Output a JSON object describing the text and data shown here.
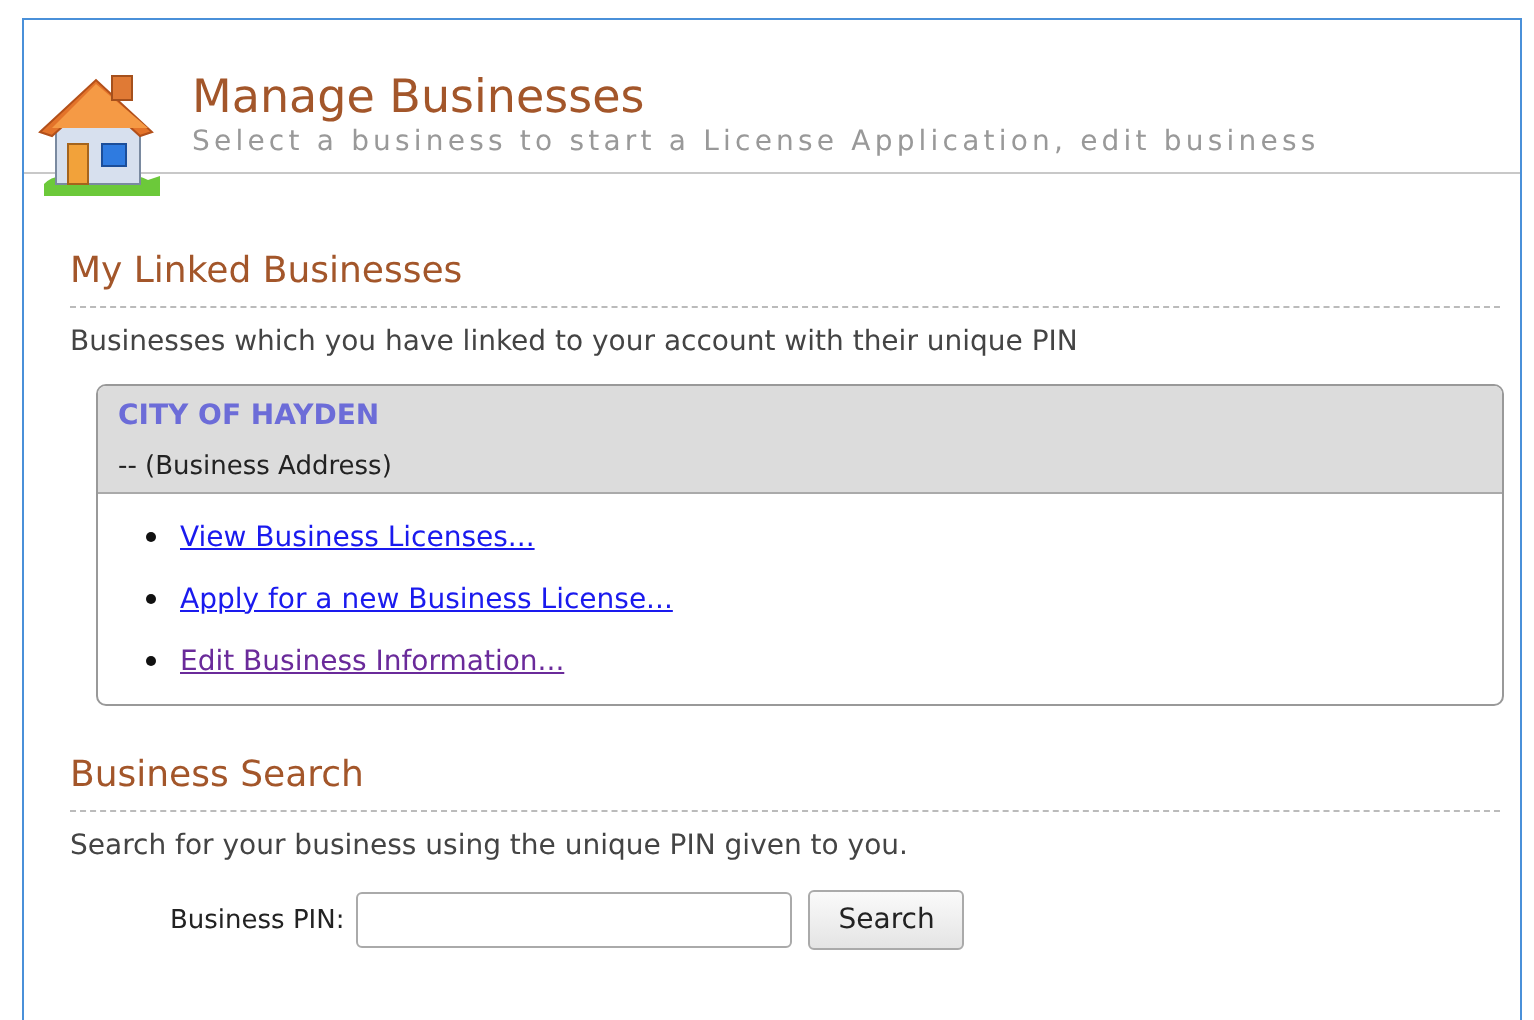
{
  "header": {
    "title": "Manage Businesses",
    "subtitle": "Select a business to start a License Application, edit business"
  },
  "linked": {
    "heading": "My Linked Businesses",
    "description": "Businesses which you have linked to your account with their unique PIN",
    "business": {
      "name": "CITY OF HAYDEN",
      "address": "-- (Business Address)",
      "links": [
        {
          "label": "View Business Licenses...",
          "visited": false
        },
        {
          "label": "Apply for a new Business License...",
          "visited": false
        },
        {
          "label": "Edit Business Information...",
          "visited": true
        }
      ]
    }
  },
  "search": {
    "heading": "Business Search",
    "description": "Search for your business using the unique PIN given to you.",
    "field_label": "Business PIN:",
    "button": "Search"
  }
}
